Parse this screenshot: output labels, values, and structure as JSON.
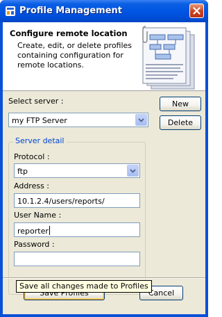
{
  "window": {
    "title": "Profile Management"
  },
  "header": {
    "title": "Configure remote location",
    "description": "Create, edit, or delete profiles containing configuration for remote locations."
  },
  "server": {
    "label": "Select server :",
    "selected": "my FTP Server",
    "new_label": "New",
    "delete_label": "Delete"
  },
  "server_detail": {
    "legend": "Server detail",
    "protocol_label": "Protocol :",
    "protocol_value": "ftp",
    "address_label": "Address :",
    "address_value": "10.1.2.4/users/reports/",
    "username_label": "User Name :",
    "username_value": "reporter",
    "password_label": "Password :",
    "password_value": ""
  },
  "footer": {
    "save_label": "Save Profiles",
    "cancel_label": "Cancel",
    "tooltip": "Save all changes made to Profiles"
  },
  "colors": {
    "titlebar": "#0054e3",
    "dialog_bg": "#ece9d8",
    "group_legend": "#0046d5",
    "tooltip_bg": "#ffffe1"
  }
}
